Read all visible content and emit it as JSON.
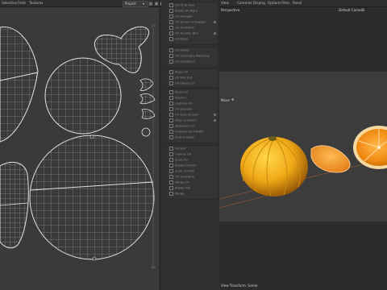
{
  "uv_editor": {
    "menu": [
      "Selection",
      "Field",
      "Textures"
    ],
    "dropdown_value": "Project",
    "coord_top": "1.0",
    "coord_bottom": "1.0"
  },
  "tools": {
    "group1": [
      "UV Fit to Area",
      "Rotate 90 Right",
      "UV Manager",
      "UV Terrain to Polygon",
      "UV Transform",
      "UV Transfer Bits",
      "UV Relax"
    ],
    "group2": [
      "UV Rotate",
      "UV Symmetry Matching",
      "UV Straighten"
    ],
    "group3": [
      "Relax UV",
      "UV Sort Out",
      "UV Island Col"
    ],
    "group4": [
      "Relax UV",
      "Seams I",
      "Ungroup UV",
      "UV Sharpen",
      "UV Strip Smooth",
      "Align to Island",
      "Sequence UV",
      "Preserve Sort Width",
      "Stretch Relax"
    ],
    "group5": [
      "UV Sort",
      "Unwrap UV",
      "Scale UV",
      "Rotate UV-Edit",
      "Scale UV-Edit",
      "UV Transform",
      "Merge UV",
      "Rotate Tile",
      "Merge"
    ]
  },
  "viewport": {
    "menu": [
      "View",
      "Cameras",
      "Display",
      "Options",
      "Filter",
      "Panel"
    ],
    "perspective": "Perspective",
    "camera": "Default Camera",
    "move_label": "Move",
    "status": "View Transform: Scene"
  }
}
